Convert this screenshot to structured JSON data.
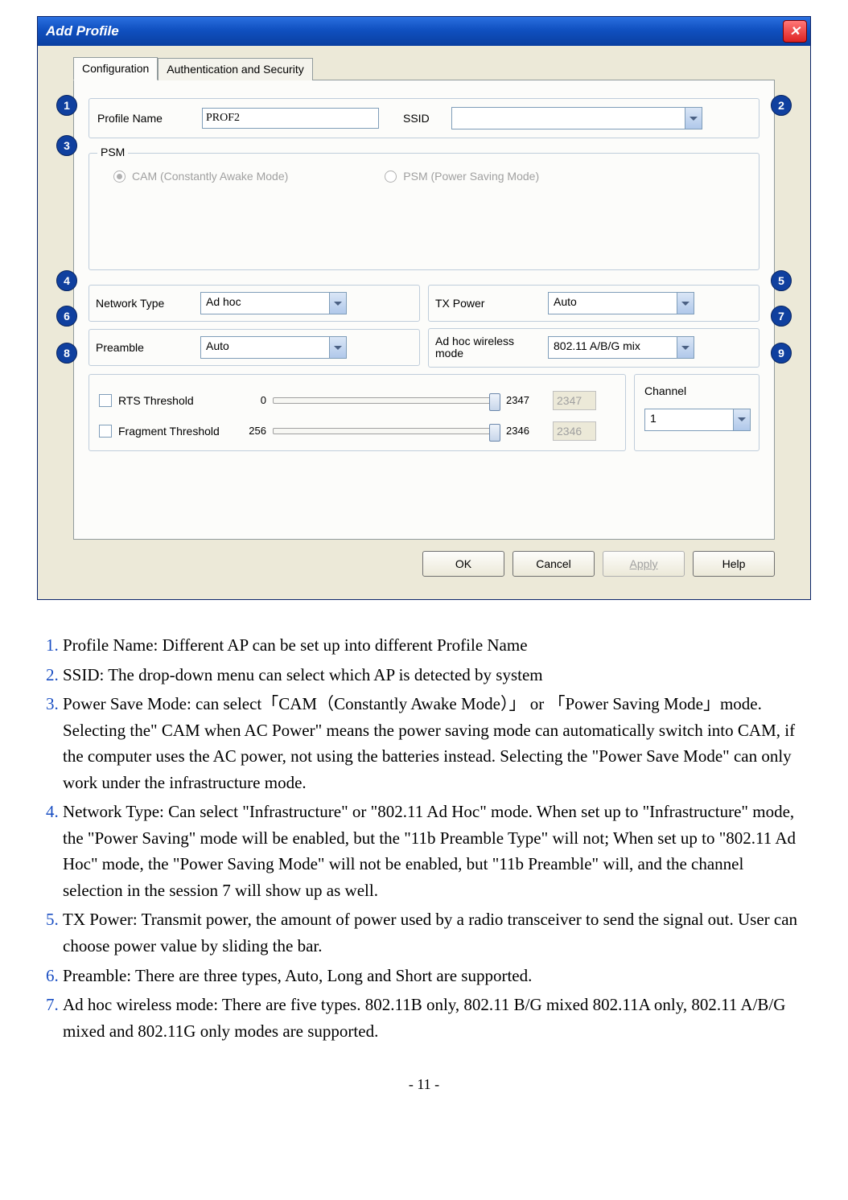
{
  "window": {
    "title": "Add Profile"
  },
  "tabs": {
    "configuration": "Configuration",
    "auth": "Authentication and Security"
  },
  "fields": {
    "profile_name_label": "Profile Name",
    "profile_name_value": "PROF2",
    "ssid_label": "SSID",
    "ssid_value": "",
    "psm_legend": "PSM",
    "cam_label": "CAM (Constantly Awake Mode)",
    "psm_label": "PSM (Power Saving Mode)",
    "network_type_label": "Network Type",
    "network_type_value": "Ad hoc",
    "tx_power_label": "TX Power",
    "tx_power_value": "Auto",
    "preamble_label": "Preamble",
    "preamble_value": "Auto",
    "adhoc_mode_label": "Ad hoc wireless mode",
    "adhoc_mode_value": "802.11 A/B/G mix",
    "rts_label": "RTS Threshold",
    "rts_min": "0",
    "rts_max": "2347",
    "rts_value": "2347",
    "frag_label": "Fragment Threshold",
    "frag_min": "256",
    "frag_max": "2346",
    "frag_value": "2346",
    "channel_label": "Channel",
    "channel_value": "1"
  },
  "buttons": {
    "ok": "OK",
    "cancel": "Cancel",
    "apply": "Apply",
    "help": "Help"
  },
  "markers": {
    "m1": "1",
    "m2": "2",
    "m3": "3",
    "m4": "4",
    "m5": "5",
    "m6": "6",
    "m7": "7",
    "m8": "8",
    "m9": "9"
  },
  "notes": {
    "n1": "Profile Name: Different AP can be set up into different Profile Name",
    "n2": "SSID: The drop-down menu can select which AP is detected by system",
    "n3": "Power Save Mode: can select「CAM（Constantly Awake Mode）」 or 「Power Saving Mode」mode.   Selecting the\" CAM when AC Power\" means the power saving mode can automatically switch into CAM, if the computer uses the AC power, not using the batteries instead. Selecting the \"Power Save Mode\" can only work under the infrastructure mode.",
    "n4": "Network Type: Can select \"Infrastructure\" or \"802.11 Ad Hoc\" mode. When set up to \"Infrastructure\" mode, the \"Power Saving\" mode will be enabled, but the \"11b Preamble Type\" will not; When set up to \"802.11 Ad Hoc\" mode, the \"Power Saving Mode\" will not be enabled, but \"11b Preamble\" will, and the channel selection in the session 7 will show up as well.",
    "n5": "TX Power: Transmit power, the amount of power used by a radio transceiver to send the signal out. User can choose power value by sliding the bar.",
    "n6": "Preamble: There are three types, Auto, Long and Short are supported.",
    "n7": "Ad hoc wireless mode: There are five types. 802.11B only, 802.11 B/G mixed 802.11A only, 802.11 A/B/G mixed and 802.11G only modes are supported."
  },
  "page_number": "- 11 -"
}
